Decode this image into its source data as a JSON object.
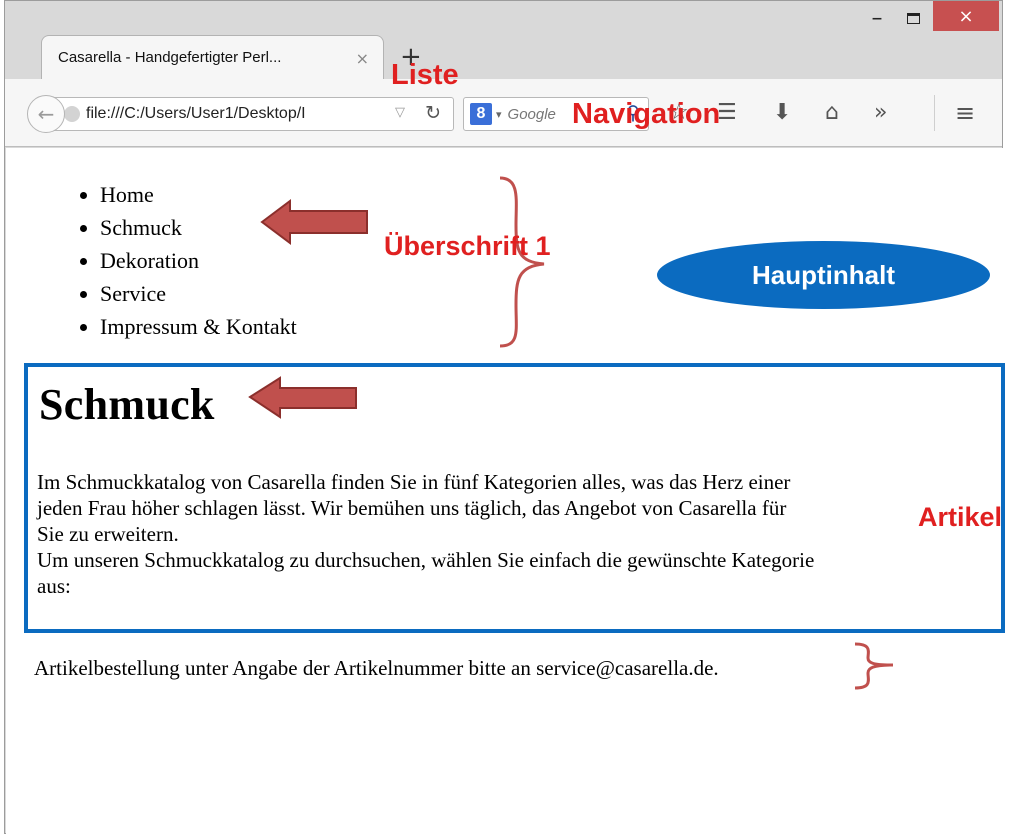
{
  "window": {
    "controls": {
      "minimize": "–",
      "maximize": "",
      "close": "×"
    }
  },
  "tab": {
    "title": "Casarella - Handgefertigter Perl...",
    "close": "×",
    "new_tab": "+"
  },
  "toolbar": {
    "url": "file:///C:/Users/User1/Desktop/I",
    "search_placeholder": "Google",
    "search_engine_letter": "8",
    "icons": [
      "back-icon",
      "reload-icon",
      "bookmark-star-icon",
      "reading-list-icon",
      "download-icon",
      "home-icon",
      "overflow-chevron-icon",
      "menu-icon"
    ]
  },
  "page": {
    "nav_items": [
      "Home",
      "Schmuck",
      "Dekoration",
      "Service",
      "Impressum & Kontakt"
    ],
    "heading": "Schmuck",
    "intro_lines": [
      "Im Schmuckkatalog von Casarella finden Sie in fünf Kategorien alles, was das Herz einer",
      "jeden Frau höher schlagen lässt. Wir bemühen uns täglich, das Angebot von Casarella für",
      "Sie zu erweitern.",
      "Um unseren Schmuckkatalog zu durchsuchen, wählen Sie einfach die gewünschte Kategorie",
      "aus:"
    ],
    "footer": "Artikelbestellung unter Angabe der Artikelnummer bitte an service@casarella.de."
  },
  "annotations": {
    "liste": "Liste",
    "navigation": "Navigation",
    "ueberschrift": "Überschrift 1",
    "hauptinhalt": "Hauptinhalt",
    "artikel": "Artikel",
    "colors": {
      "label": "#e02020",
      "arrow_fill": "#c0504d",
      "arrow_stroke": "#8b2f2c",
      "main_box": "#0b6bc0",
      "brace": "#c0504d"
    }
  }
}
